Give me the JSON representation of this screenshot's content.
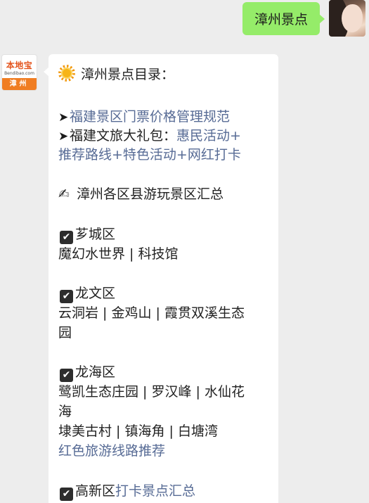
{
  "outgoing": {
    "text": "漳州景点"
  },
  "bot": {
    "logo_text": "本地宝",
    "logo_site": "Bendibao.com",
    "logo_city": "漳州"
  },
  "message": {
    "title": "漳州景点目录：",
    "links": [
      {
        "arrow": "➤",
        "text": "福建景区门票价格管理规范"
      }
    ],
    "pack": {
      "arrow": "➤",
      "prefix": "福建文旅大礼包：",
      "part1": "惠民活动+",
      "part2": "推荐路线+特色活动+网红打卡"
    },
    "summary": {
      "icon": "✍",
      "text": "漳州各区县游玩景区汇总"
    },
    "districts": [
      {
        "name": "芗城区",
        "lines": [
          "魔幻水世界 | 科技馆"
        ]
      },
      {
        "name": "龙文区",
        "lines": [
          "云洞岩 | 金鸡山 | 霞贯双溪生态",
          "园"
        ]
      },
      {
        "name": "龙海区",
        "lines": [
          "鹭凯生态庄园 | 罗汉峰 | 水仙花",
          "海",
          "埭美古村 | 镇海角 | 白塘湾"
        ],
        "link": "红色旅游线路推荐"
      },
      {
        "name": "高新区",
        "link": "打卡景点汇总"
      }
    ],
    "check_icon": "✔"
  },
  "colors": {
    "link": "#576b95",
    "bubble_out": "#95ec69",
    "bubble_in": "#ffffff",
    "background": "#ededed"
  }
}
